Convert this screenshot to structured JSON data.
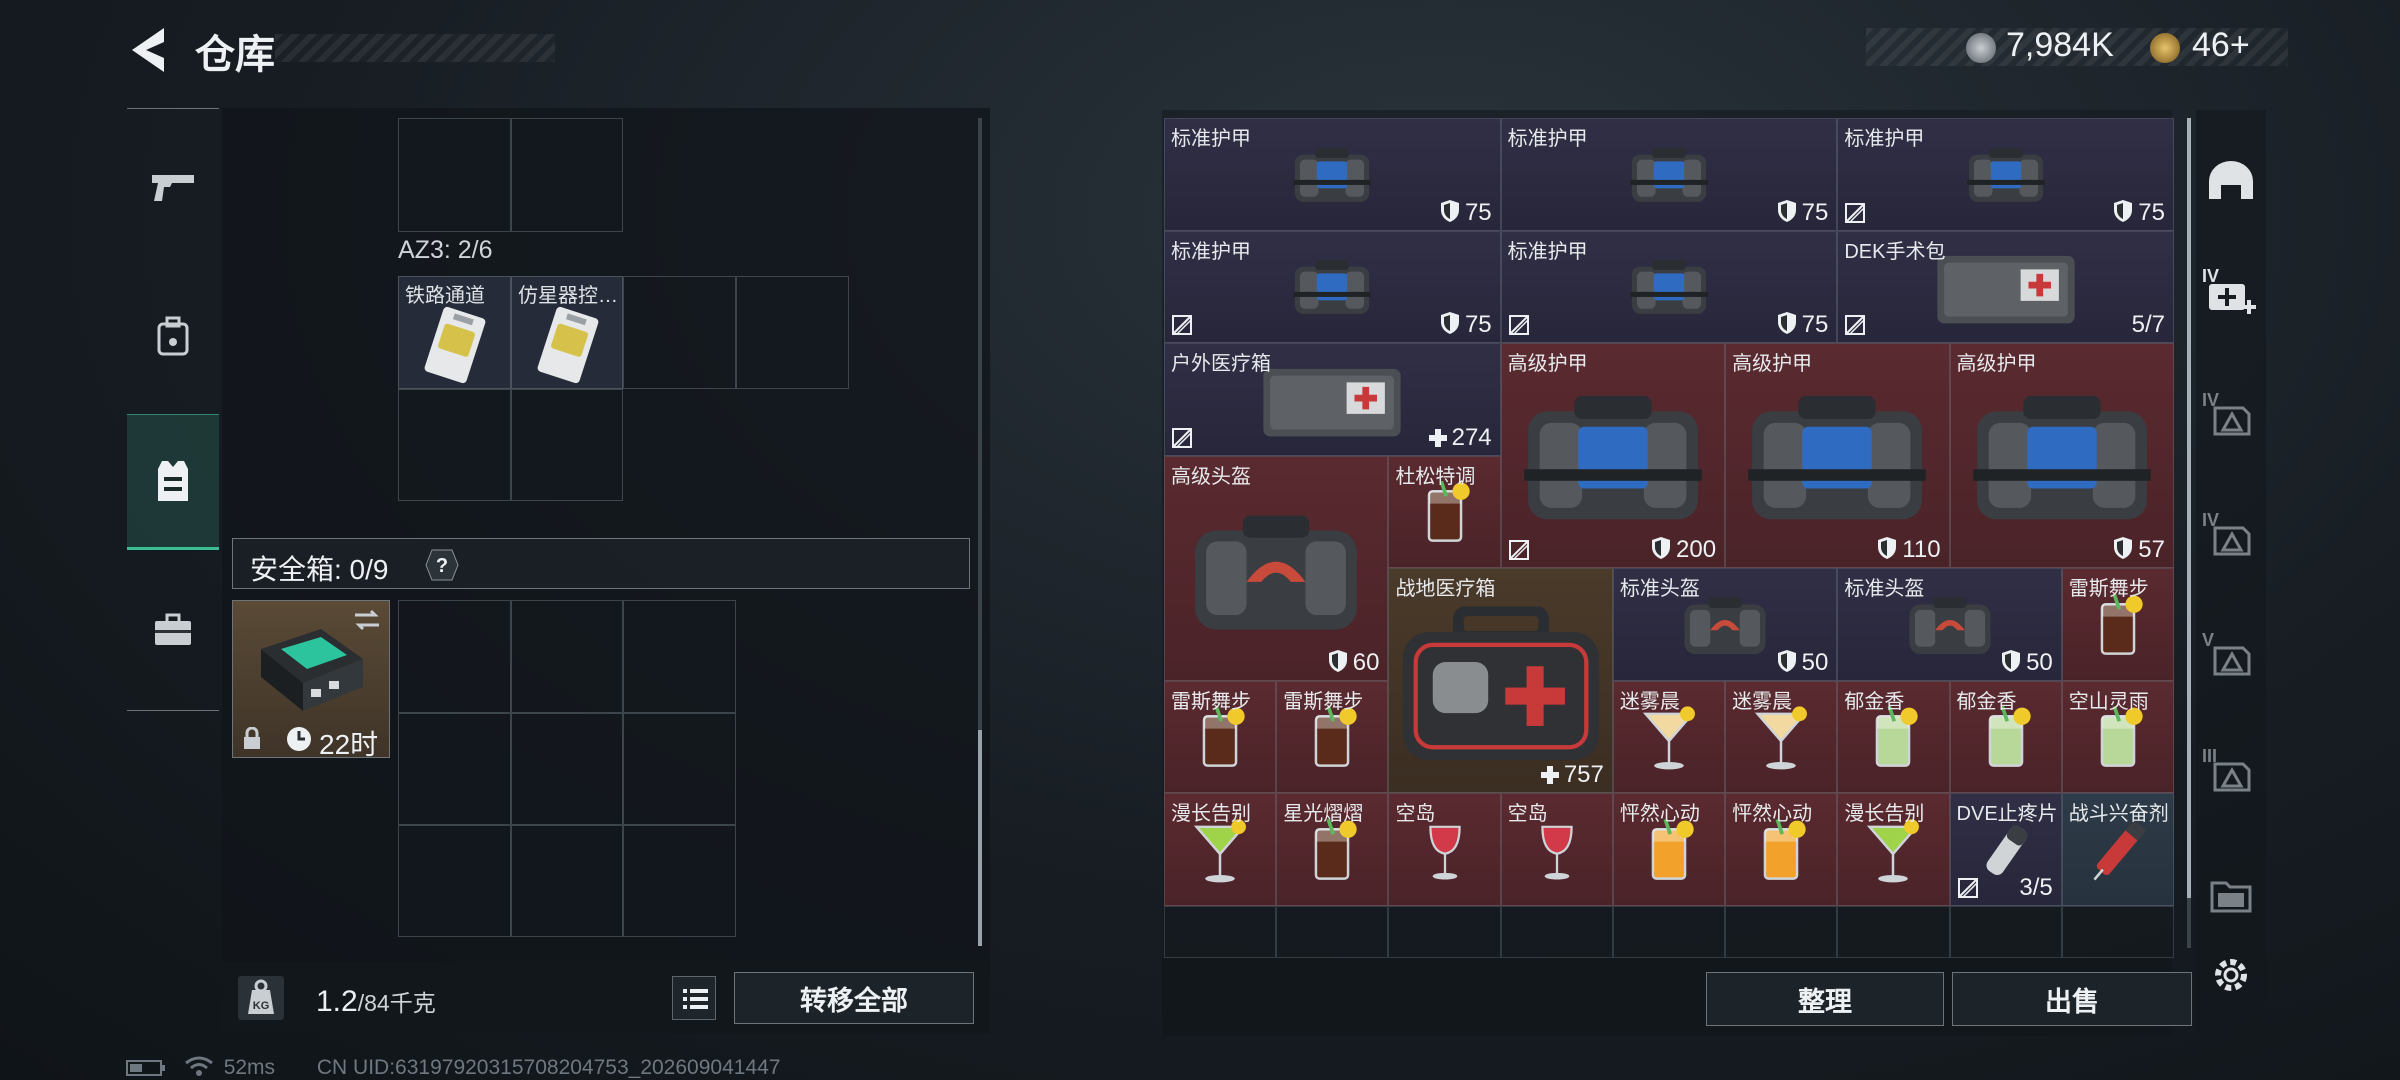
{
  "header": {
    "title": "仓库",
    "currency_primary": "7,984K",
    "currency_secondary": "46+"
  },
  "left_nav": {
    "items": [
      {
        "icon": "pistol-icon",
        "active": false
      },
      {
        "icon": "backpack-icon",
        "active": false
      },
      {
        "icon": "vest-icon",
        "active": true
      },
      {
        "icon": "briefcase-icon",
        "active": false
      }
    ]
  },
  "container": {
    "az3_label": "AZ3: 2/6",
    "items": [
      {
        "name": "铁路通道",
        "icon": "keycard-icon"
      },
      {
        "name": "仿星器控…",
        "icon": "keycard-icon"
      }
    ]
  },
  "safebox": {
    "label": "安全箱: 0/9",
    "help": "?",
    "timer": "22时"
  },
  "footer_left": {
    "weight": "1.2",
    "weight_max": "/84千克",
    "transfer_all": "转移全部"
  },
  "status": {
    "ping": "52ms",
    "uid": "CN UID:63197920315708204753_202609041447"
  },
  "stash": {
    "slots": [
      {
        "name": "标准护甲",
        "value": "75",
        "tag": "shield",
        "color": "blue",
        "art": "vest",
        "unlocked": false
      },
      {
        "name": "标准护甲",
        "value": "75",
        "tag": "shield",
        "color": "blue",
        "art": "vest",
        "unlocked": false
      },
      {
        "name": "标准护甲",
        "value": "75",
        "tag": "shield",
        "color": "blue",
        "art": "vest",
        "unlocked": true
      },
      {
        "name": "标准护甲",
        "value": "75",
        "tag": "shield",
        "color": "blue",
        "art": "vest",
        "unlocked": true
      },
      {
        "name": "标准护甲",
        "value": "75",
        "tag": "shield",
        "color": "blue",
        "art": "vest",
        "unlocked": true
      },
      {
        "name": "DEK手术包",
        "value": "5/7",
        "tag": "none",
        "color": "blue",
        "art": "medkit-grey",
        "unlocked": true
      },
      {
        "name": "户外医疗箱",
        "value": "274",
        "tag": "plus",
        "color": "blue",
        "art": "medkit-grey",
        "unlocked": true
      },
      {
        "name": "高级护甲",
        "value": "200",
        "tag": "shield",
        "color": "red",
        "art": "vest-big",
        "unlocked": true
      },
      {
        "name": "高级护甲",
        "value": "110",
        "tag": "shield",
        "color": "red",
        "art": "vest-big",
        "unlocked": false
      },
      {
        "name": "高级护甲",
        "value": "57",
        "tag": "shield",
        "color": "red",
        "art": "vest-big",
        "unlocked": false
      },
      {
        "name": "高级头盔",
        "value": "60",
        "tag": "shield",
        "color": "red",
        "art": "helmet",
        "unlocked": false
      },
      {
        "name": "杜松特调",
        "value": "",
        "tag": "none",
        "color": "red",
        "art": "drink-dark",
        "unlocked": false
      },
      {
        "name": "战地医疗箱",
        "value": "757",
        "tag": "plus",
        "color": "brown",
        "art": "medkit-red",
        "unlocked": false
      },
      {
        "name": "标准头盔",
        "value": "50",
        "tag": "shield",
        "color": "blue",
        "art": "helmet",
        "unlocked": false
      },
      {
        "name": "标准头盔",
        "value": "50",
        "tag": "shield",
        "color": "blue",
        "art": "helmet",
        "unlocked": false
      },
      {
        "name": "雷斯舞步",
        "value": "",
        "tag": "none",
        "color": "red",
        "art": "drink-dark",
        "unlocked": false
      },
      {
        "name": "雷斯舞步",
        "value": "",
        "tag": "none",
        "color": "red",
        "art": "drink-dark",
        "unlocked": false
      },
      {
        "name": "雷斯舞步",
        "value": "",
        "tag": "none",
        "color": "red",
        "art": "drink-dark",
        "unlocked": false
      },
      {
        "name": "迷雾晨",
        "value": "",
        "tag": "none",
        "color": "red",
        "art": "martini",
        "unlocked": false
      },
      {
        "name": "迷雾晨",
        "value": "",
        "tag": "none",
        "color": "red",
        "art": "martini",
        "unlocked": false
      },
      {
        "name": "郁金香",
        "value": "",
        "tag": "none",
        "color": "red",
        "art": "drink-green",
        "unlocked": false
      },
      {
        "name": "郁金香",
        "value": "",
        "tag": "none",
        "color": "red",
        "art": "drink-green",
        "unlocked": false
      },
      {
        "name": "空山灵雨",
        "value": "",
        "tag": "none",
        "color": "red",
        "art": "drink-green",
        "unlocked": false
      },
      {
        "name": "漫长告别",
        "value": "",
        "tag": "none",
        "color": "red",
        "art": "martini-green",
        "unlocked": false
      },
      {
        "name": "星光熠熠",
        "value": "",
        "tag": "none",
        "color": "red",
        "art": "drink-dark",
        "unlocked": false
      },
      {
        "name": "空岛",
        "value": "",
        "tag": "none",
        "color": "red",
        "art": "wine",
        "unlocked": false
      },
      {
        "name": "空岛",
        "value": "",
        "tag": "none",
        "color": "red",
        "art": "wine",
        "unlocked": false
      },
      {
        "name": "怦然心动",
        "value": "",
        "tag": "none",
        "color": "red",
        "art": "drink-orange",
        "unlocked": false
      },
      {
        "name": "怦然心动",
        "value": "",
        "tag": "none",
        "color": "red",
        "art": "drink-orange",
        "unlocked": false
      },
      {
        "name": "漫长告别",
        "value": "",
        "tag": "none",
        "color": "red",
        "art": "martini-green",
        "unlocked": false
      },
      {
        "name": "DVE止疼片",
        "value": "3/5",
        "tag": "none",
        "color": "blue",
        "art": "pills",
        "unlocked": true
      },
      {
        "name": "战斗兴奋剂",
        "value": "",
        "tag": "none",
        "color": "teal",
        "art": "syringe",
        "unlocked": false
      }
    ]
  },
  "footer_right": {
    "sort": "整理",
    "sell": "出售"
  },
  "right_nav": {
    "items": [
      {
        "icon": "helmet-icon",
        "tier": ""
      },
      {
        "icon": "medkit-add-icon",
        "tier": "IV"
      },
      {
        "icon": "armor-tier-icon",
        "tier": "IV"
      },
      {
        "icon": "armor-tier-icon",
        "tier": "IV"
      },
      {
        "icon": "ammo-tier-icon",
        "tier": "V"
      },
      {
        "icon": "armor-tier-icon",
        "tier": "III"
      },
      {
        "icon": "folder-icon",
        "tier": ""
      },
      {
        "icon": "settings-icon",
        "tier": ""
      }
    ]
  }
}
